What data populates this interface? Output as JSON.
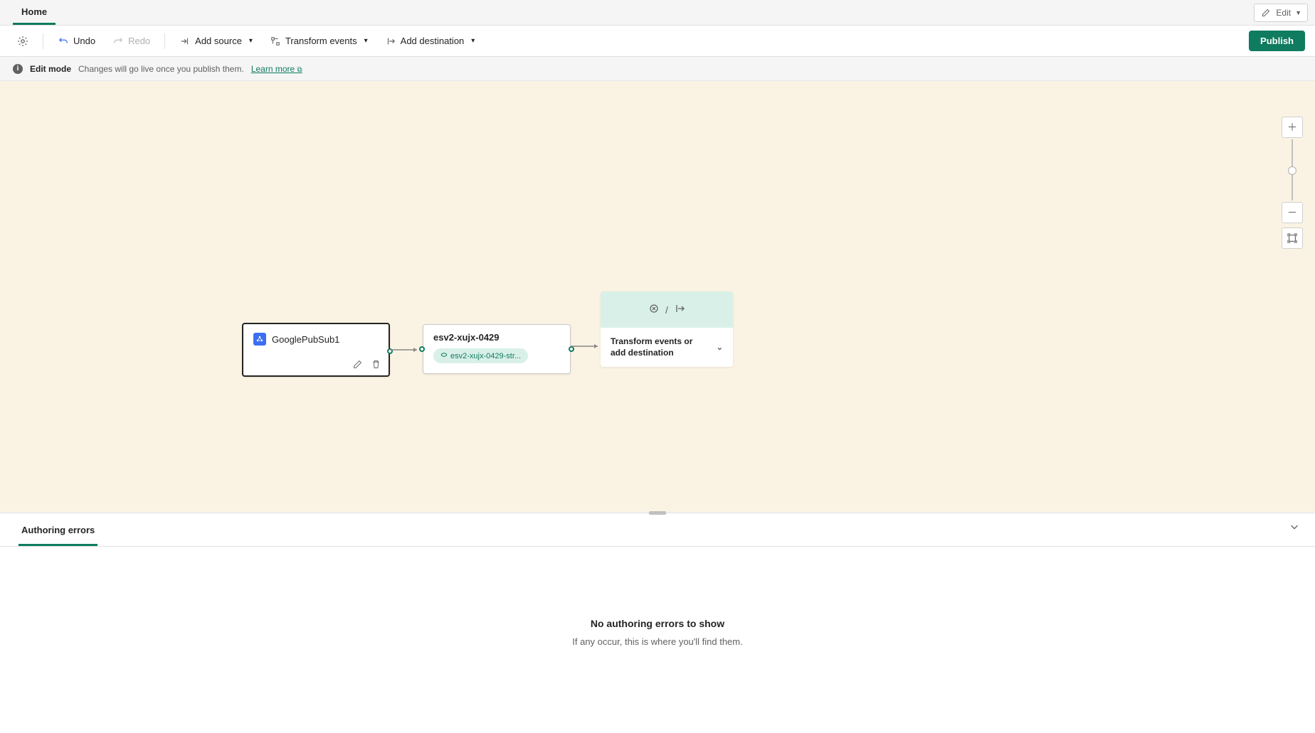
{
  "tabs": {
    "home": "Home"
  },
  "edit_dropdown": {
    "label": "Edit"
  },
  "toolbar": {
    "undo": "Undo",
    "redo": "Redo",
    "add_source": "Add source",
    "transform": "Transform events",
    "add_destination": "Add destination",
    "publish": "Publish"
  },
  "info": {
    "mode": "Edit mode",
    "message": "Changes will go live once you publish them.",
    "learn_more": "Learn more"
  },
  "nodes": {
    "source": {
      "title": "GooglePubSub1"
    },
    "stream": {
      "title": "esv2-xujx-0429",
      "pill": "esv2-xujx-0429-str..."
    },
    "dest": {
      "label": "Transform events or add destination"
    }
  },
  "panel": {
    "tab": "Authoring errors",
    "empty_title": "No authoring errors to show",
    "empty_sub": "If any occur, this is where you'll find them."
  }
}
